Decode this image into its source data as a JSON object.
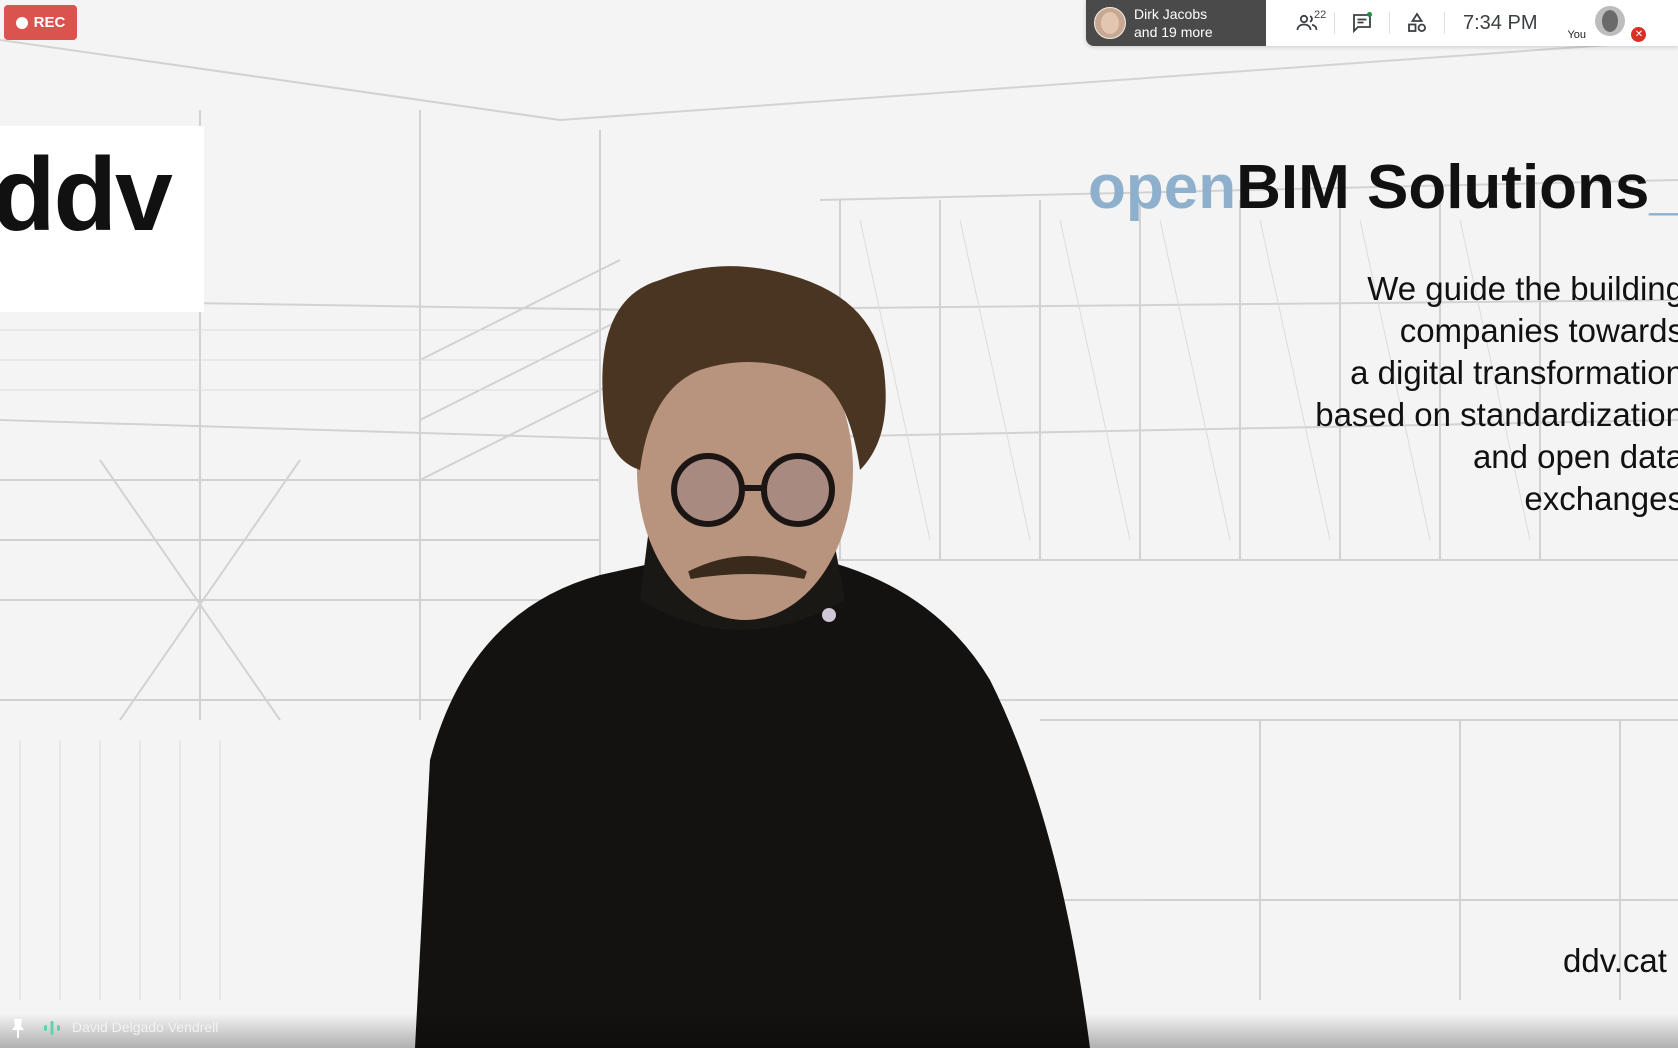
{
  "recording": {
    "label": "REC",
    "color": "#d9534f"
  },
  "active_speaker": {
    "name": "Dirk Jacobs",
    "more": "and 19 more"
  },
  "participants": {
    "count": "22"
  },
  "clock": {
    "time": "7:34 PM"
  },
  "self_view": {
    "label": "You",
    "muted": true
  },
  "slide": {
    "logo": "ddv",
    "title_accent": "open",
    "title_main": "BIM Solutions",
    "title_cursor": "_",
    "accent_color": "#8fb0cc",
    "body_lines": [
      "We guide the building",
      "companies towards",
      "a digital transformation",
      "based on standardization",
      "and open data",
      "exchanges"
    ],
    "url": "ddv.cat"
  },
  "presenter": {
    "name": "David Delgado Vendrell"
  },
  "icons": [
    "pin-icon",
    "audio-wave-icon",
    "people-icon",
    "chat-icon",
    "activities-icon",
    "mic-off-icon"
  ]
}
